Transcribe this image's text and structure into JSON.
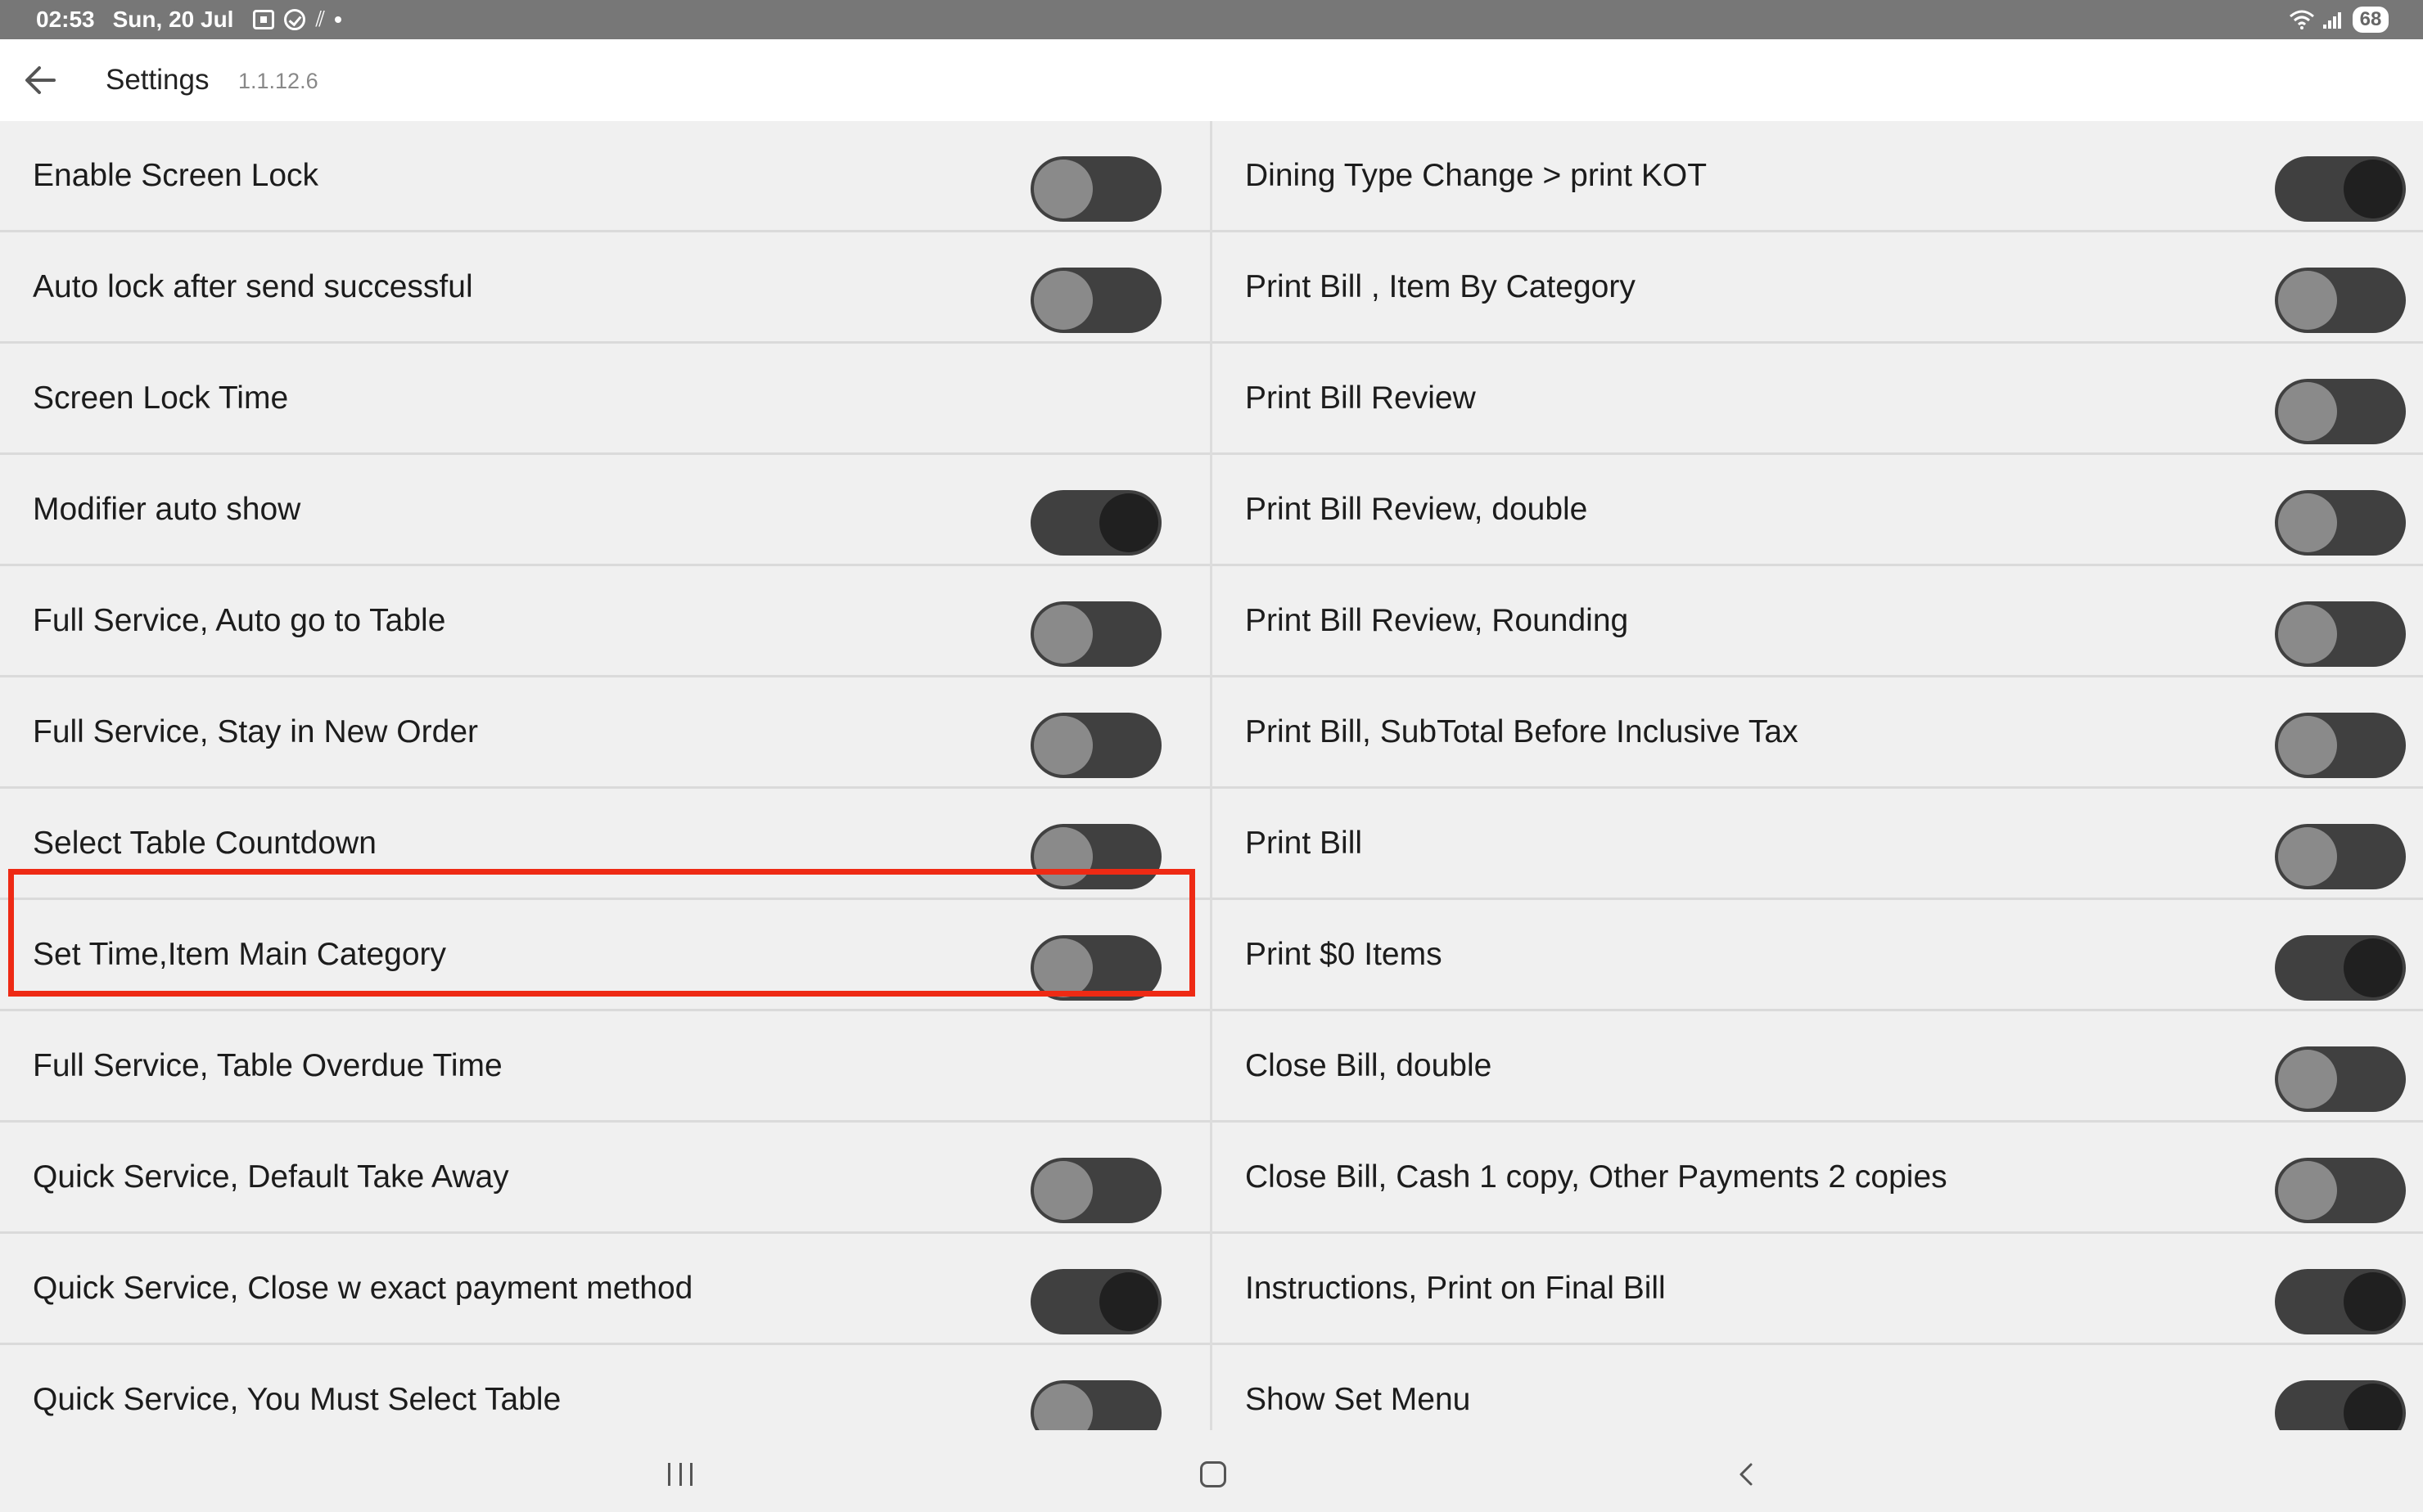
{
  "status_bar": {
    "time": "02:53",
    "date": "Sun, 20 Jul",
    "battery": "68"
  },
  "header": {
    "title": "Settings",
    "version": "1.1.12.6"
  },
  "left_settings": [
    {
      "label": "Enable Screen Lock",
      "toggle": "off"
    },
    {
      "label": "Auto lock after send successful",
      "toggle": "off"
    },
    {
      "label": "Screen Lock Time",
      "toggle": "none"
    },
    {
      "label": "Modifier auto show",
      "toggle": "on"
    },
    {
      "label": "Full Service, Auto go to Table",
      "toggle": "off"
    },
    {
      "label": "Full Service, Stay in New Order",
      "toggle": "off"
    },
    {
      "label": "Select Table Countdown",
      "toggle": "off"
    },
    {
      "label": "Set Time,Item Main Category",
      "toggle": "off"
    },
    {
      "label": "Full Service, Table Overdue Time",
      "toggle": "none"
    },
    {
      "label": "Quick Service, Default Take Away",
      "toggle": "off"
    },
    {
      "label": "Quick Service, Close w exact payment method",
      "toggle": "on"
    },
    {
      "label": "Quick Service, You Must Select Table",
      "toggle": "off"
    }
  ],
  "right_settings": [
    {
      "label": "Dining Type Change > print KOT",
      "toggle": "on"
    },
    {
      "label": "Print Bill , Item By Category",
      "toggle": "off"
    },
    {
      "label": "Print Bill Review",
      "toggle": "off"
    },
    {
      "label": "Print Bill Review, double",
      "toggle": "off"
    },
    {
      "label": "Print Bill Review, Rounding",
      "toggle": "off"
    },
    {
      "label": "Print Bill, SubTotal Before Inclusive Tax",
      "toggle": "off"
    },
    {
      "label": "Print Bill",
      "toggle": "off"
    },
    {
      "label": "Print $0 Items",
      "toggle": "on"
    },
    {
      "label": "Close Bill, double",
      "toggle": "off"
    },
    {
      "label": "Close Bill, Cash 1 copy, Other Payments 2 copies",
      "toggle": "off"
    },
    {
      "label": "Instructions, Print on Final Bill",
      "toggle": "on"
    },
    {
      "label": "Show Set Menu",
      "toggle": "on"
    }
  ],
  "highlight_color": "#ee2a14",
  "icons": [
    "back-arrow-icon",
    "recent-apps-icon",
    "home-icon",
    "nav-back-icon",
    "wifi-icon",
    "signal-icon",
    "battery-icon"
  ]
}
